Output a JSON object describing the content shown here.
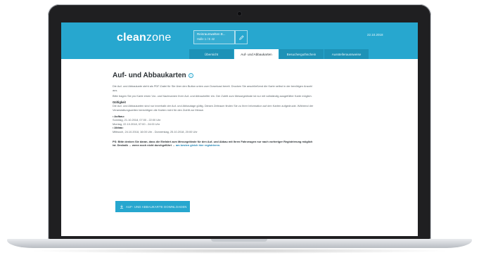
{
  "header": {
    "brand_bold": "clean",
    "brand_light": "zone",
    "account_line1": "Reinraumwelten B...",
    "account_line2": "Halle 1 / E 42",
    "date": "22.10.2018"
  },
  "tabs": [
    {
      "label": "Übersicht",
      "active": false
    },
    {
      "label": "Auf- und Abbaukarten",
      "active": true
    },
    {
      "label": "Besucherguthschein",
      "active": false
    },
    {
      "label": "Ausstelleraussweise",
      "active": false
    }
  ],
  "content": {
    "title": "Auf- und Abbaukarten",
    "intro_p1": "Die Auf- und Abbaukarte steht als PDF-Datei für Sie über den Button unten zum Download bereit. Drucken Sie anschließend die Karte selbst in der benötigen Anzahl aus.",
    "intro_p2": "Bitte tragen Sie pro Karte einen Vor- und Nachnamen Ihrer Auf- und Abbauhelfer ein. Der Zutritt zum Messegelände ist nur mit vollständig ausgefüllter Karte möglich.",
    "validity_heading": "Gültigkeit",
    "validity_text": "Die Auf- und Abbaukarten sind nur innerhalb der Auf- und Abbautage gültig. Diesen Zeitraum finden Sie zu Ihrer Information auf den Karten aufgedruckt. Während der Veranstaltungszeiten berechtigen die Karten nicht für den Zutritt zur Messe.",
    "setup_label": "• Aufbau:",
    "setup_line1": "Sonntag, 21.10.2018, 07:00 - 22:00 Uhr",
    "setup_line2": "Montag, 22.10.2018, 07:00 - 24:00 Uhr",
    "teardown_label": "• Abbau:",
    "teardown_line1": "Mittwoch, 24.10.2018, 16:00 Uhr - Donnerstag, 25.10.2018, 20:00 Uhr",
    "note_text": "PS: Bitte denken Sie daran, dass die Einfahrt zum Messegelände für den Auf- und Abbau mit Ihren Fahrzeugen nur nach vorheriger Registrierung möglich ist. Deshalb → wenn noch nicht durchgeführt →",
    "note_link": "am besten gleich hier registrieren.",
    "download_label": "AUF- UND ABBAUKARTE DOWNLOADEN"
  },
  "colors": {
    "accent": "#27a7cf",
    "tab_inactive": "#1d92b7",
    "bezel": "#1f1f21"
  },
  "icons": {
    "edit": "pencil-icon",
    "info": "info-icon",
    "download": "download-icon"
  }
}
